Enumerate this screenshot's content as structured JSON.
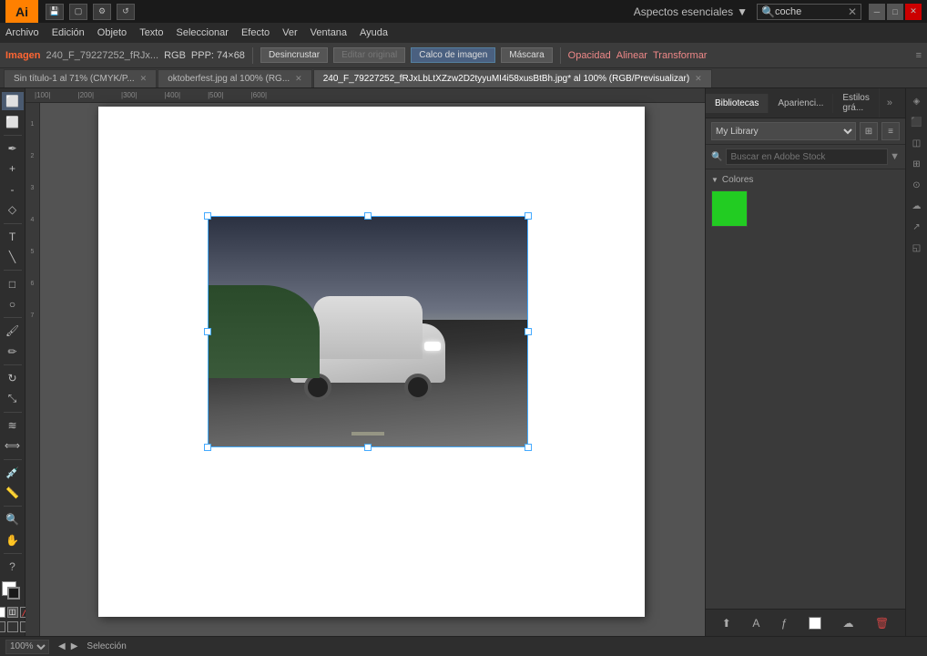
{
  "titlebar": {
    "logo": "Ai",
    "workspace_label": "Aspectos esenciales",
    "search_placeholder": "coche",
    "search_value": "coche"
  },
  "menubar": {
    "items": [
      "Archivo",
      "Edición",
      "Objeto",
      "Texto",
      "Seleccionar",
      "Efecto",
      "Ver",
      "Ventana",
      "Ayuda"
    ]
  },
  "propsbar": {
    "label": "Imagen",
    "filename": "240_F_79227252_fRJx...",
    "colormode": "RGB",
    "ppp": "PPP: 74×68",
    "desincrustar": "Desincrustar",
    "editar_original": "Editar original",
    "calco": "Calco de imagen",
    "mascara": "Máscara",
    "opacidad": "Opacidad",
    "alinear": "Alinear",
    "transformar": "Transformar"
  },
  "tabs": [
    {
      "label": "Sin título-1 al 71% (CMYK/P...",
      "active": false
    },
    {
      "label": "oktoberfest.jpg al 100% (RG...",
      "active": false
    },
    {
      "label": "240_F_79227252_fRJxLbLtXZzw2D2tyyuMI4i58xusBtBh.jpg* al 100% (RGB/Previsualizar)",
      "active": true
    }
  ],
  "libraries": {
    "panel_tabs": [
      "Bibliotecas",
      "Aparienci...",
      "Estilos grá..."
    ],
    "library_name": "My Library",
    "search_placeholder": "Buscar en Adobe Stock",
    "colors_section": "Colores",
    "color_value": "#22cc22"
  },
  "status": {
    "zoom": "100%",
    "tool": "Selección"
  },
  "bottom_icons": {
    "draw_mode": "◻",
    "color_mode": "⬛"
  }
}
